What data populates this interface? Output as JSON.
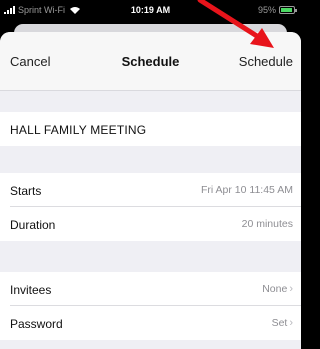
{
  "status_bar": {
    "carrier": "Sprint Wi-Fi",
    "time": "10:19 AM",
    "battery": "95%",
    "battery_level": 0.95
  },
  "nav": {
    "cancel_label": "Cancel",
    "title": "Schedule",
    "action_label": "Schedule"
  },
  "meeting": {
    "title": "HALL FAMILY MEETING"
  },
  "details": {
    "starts_label": "Starts",
    "starts_value": "Fri Apr 10 11:45 AM",
    "duration_label": "Duration",
    "duration_value": "20 minutes"
  },
  "options": {
    "invitees_label": "Invitees",
    "invitees_value": "None",
    "password_label": "Password",
    "password_value": "Set"
  },
  "colors": {
    "annotation_arrow": "#e8141b",
    "battery_fill": "#4cd964"
  }
}
